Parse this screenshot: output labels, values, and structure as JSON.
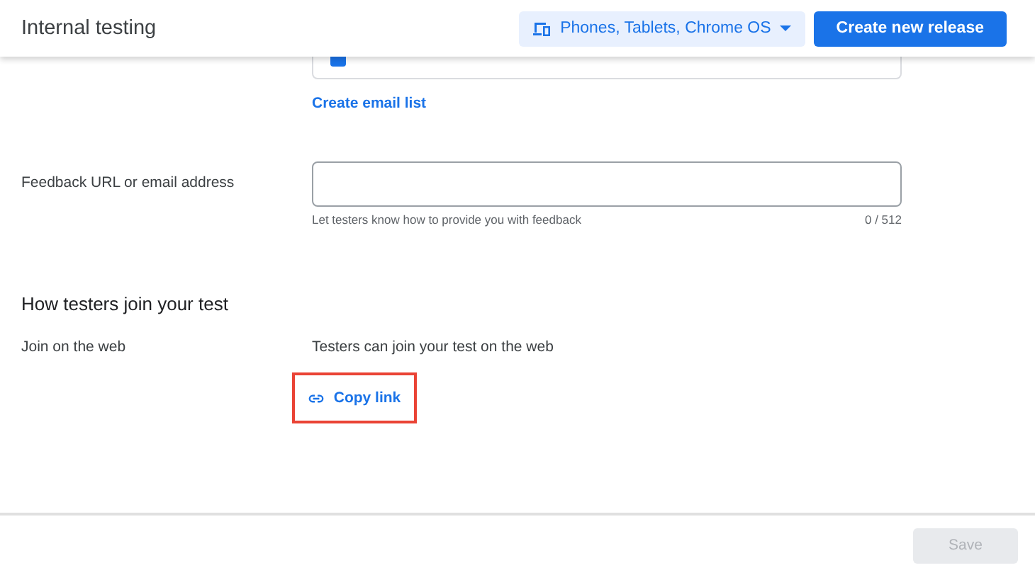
{
  "header": {
    "title": "Internal testing",
    "device_menu": "Phones, Tablets, Chrome OS",
    "primary_button": "Create new release"
  },
  "list_card": {
    "checkbox_checked": true
  },
  "create_email_list": "Create email list",
  "feedback": {
    "label": "Feedback URL or email address",
    "helper": "Let testers know how to provide you with feedback",
    "counter": "0 / 512"
  },
  "join_section": {
    "heading": "How testers join your test",
    "label": "Join on the web",
    "description": "Testers can join your test on the web",
    "copy_link": "Copy link"
  },
  "footer": {
    "save_button": "Save",
    "save_disabled": true
  }
}
